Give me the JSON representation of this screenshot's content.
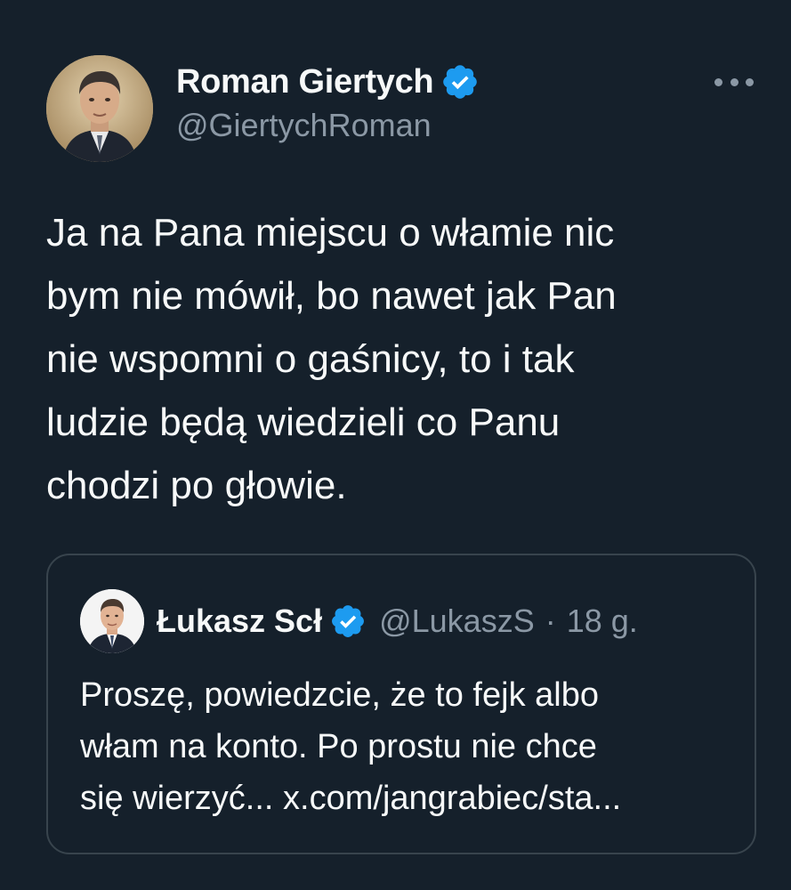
{
  "tweet": {
    "author": {
      "display_name": "Roman Giertych",
      "handle": "@GiertychRoman",
      "avatar_icon": "portrait-avatar",
      "verified_icon": "verified-badge-icon"
    },
    "more_icon": "more-options-icon",
    "text": "Ja na Pana miejscu o włamie nic\nbym nie mówił, bo nawet jak Pan\nnie wspomni o gaśnicy, to i tak\nludzie będą wiedzieli co Panu\nchodzi po głowie."
  },
  "quote": {
    "author": {
      "display_name": "Łukasz Scł",
      "handle": "@LukaszS",
      "separator": "·",
      "time": "18 g.",
      "avatar_icon": "portrait-avatar",
      "verified_icon": "verified-badge-icon"
    },
    "text": "Proszę, powiedzcie, że to fejk albo\nwłam na konto. Po prostu nie chce\nsię wierzyć... x.com/jangrabiec/sta..."
  },
  "colors": {
    "background": "#15202b",
    "text_primary": "#f7f9f9",
    "text_secondary": "#8b98a5",
    "border": "#38444d",
    "verified_blue": "#1d9bf0"
  }
}
